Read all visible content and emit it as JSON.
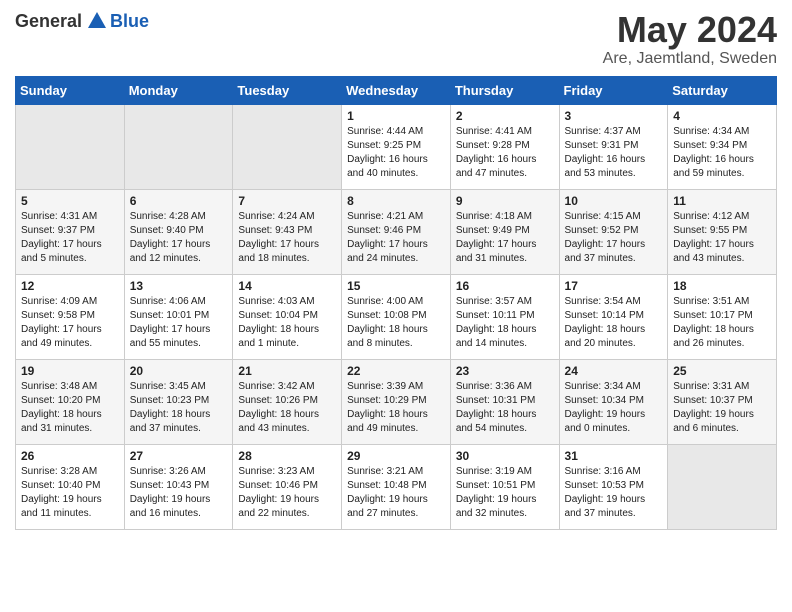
{
  "header": {
    "logo_general": "General",
    "logo_blue": "Blue",
    "month": "May 2024",
    "location": "Are, Jaemtland, Sweden"
  },
  "days_of_week": [
    "Sunday",
    "Monday",
    "Tuesday",
    "Wednesday",
    "Thursday",
    "Friday",
    "Saturday"
  ],
  "weeks": [
    [
      {
        "day": "",
        "info": ""
      },
      {
        "day": "",
        "info": ""
      },
      {
        "day": "",
        "info": ""
      },
      {
        "day": "1",
        "info": "Sunrise: 4:44 AM\nSunset: 9:25 PM\nDaylight: 16 hours\nand 40 minutes."
      },
      {
        "day": "2",
        "info": "Sunrise: 4:41 AM\nSunset: 9:28 PM\nDaylight: 16 hours\nand 47 minutes."
      },
      {
        "day": "3",
        "info": "Sunrise: 4:37 AM\nSunset: 9:31 PM\nDaylight: 16 hours\nand 53 minutes."
      },
      {
        "day": "4",
        "info": "Sunrise: 4:34 AM\nSunset: 9:34 PM\nDaylight: 16 hours\nand 59 minutes."
      }
    ],
    [
      {
        "day": "5",
        "info": "Sunrise: 4:31 AM\nSunset: 9:37 PM\nDaylight: 17 hours\nand 5 minutes."
      },
      {
        "day": "6",
        "info": "Sunrise: 4:28 AM\nSunset: 9:40 PM\nDaylight: 17 hours\nand 12 minutes."
      },
      {
        "day": "7",
        "info": "Sunrise: 4:24 AM\nSunset: 9:43 PM\nDaylight: 17 hours\nand 18 minutes."
      },
      {
        "day": "8",
        "info": "Sunrise: 4:21 AM\nSunset: 9:46 PM\nDaylight: 17 hours\nand 24 minutes."
      },
      {
        "day": "9",
        "info": "Sunrise: 4:18 AM\nSunset: 9:49 PM\nDaylight: 17 hours\nand 31 minutes."
      },
      {
        "day": "10",
        "info": "Sunrise: 4:15 AM\nSunset: 9:52 PM\nDaylight: 17 hours\nand 37 minutes."
      },
      {
        "day": "11",
        "info": "Sunrise: 4:12 AM\nSunset: 9:55 PM\nDaylight: 17 hours\nand 43 minutes."
      }
    ],
    [
      {
        "day": "12",
        "info": "Sunrise: 4:09 AM\nSunset: 9:58 PM\nDaylight: 17 hours\nand 49 minutes."
      },
      {
        "day": "13",
        "info": "Sunrise: 4:06 AM\nSunset: 10:01 PM\nDaylight: 17 hours\nand 55 minutes."
      },
      {
        "day": "14",
        "info": "Sunrise: 4:03 AM\nSunset: 10:04 PM\nDaylight: 18 hours\nand 1 minute."
      },
      {
        "day": "15",
        "info": "Sunrise: 4:00 AM\nSunset: 10:08 PM\nDaylight: 18 hours\nand 8 minutes."
      },
      {
        "day": "16",
        "info": "Sunrise: 3:57 AM\nSunset: 10:11 PM\nDaylight: 18 hours\nand 14 minutes."
      },
      {
        "day": "17",
        "info": "Sunrise: 3:54 AM\nSunset: 10:14 PM\nDaylight: 18 hours\nand 20 minutes."
      },
      {
        "day": "18",
        "info": "Sunrise: 3:51 AM\nSunset: 10:17 PM\nDaylight: 18 hours\nand 26 minutes."
      }
    ],
    [
      {
        "day": "19",
        "info": "Sunrise: 3:48 AM\nSunset: 10:20 PM\nDaylight: 18 hours\nand 31 minutes."
      },
      {
        "day": "20",
        "info": "Sunrise: 3:45 AM\nSunset: 10:23 PM\nDaylight: 18 hours\nand 37 minutes."
      },
      {
        "day": "21",
        "info": "Sunrise: 3:42 AM\nSunset: 10:26 PM\nDaylight: 18 hours\nand 43 minutes."
      },
      {
        "day": "22",
        "info": "Sunrise: 3:39 AM\nSunset: 10:29 PM\nDaylight: 18 hours\nand 49 minutes."
      },
      {
        "day": "23",
        "info": "Sunrise: 3:36 AM\nSunset: 10:31 PM\nDaylight: 18 hours\nand 54 minutes."
      },
      {
        "day": "24",
        "info": "Sunrise: 3:34 AM\nSunset: 10:34 PM\nDaylight: 19 hours\nand 0 minutes."
      },
      {
        "day": "25",
        "info": "Sunrise: 3:31 AM\nSunset: 10:37 PM\nDaylight: 19 hours\nand 6 minutes."
      }
    ],
    [
      {
        "day": "26",
        "info": "Sunrise: 3:28 AM\nSunset: 10:40 PM\nDaylight: 19 hours\nand 11 minutes."
      },
      {
        "day": "27",
        "info": "Sunrise: 3:26 AM\nSunset: 10:43 PM\nDaylight: 19 hours\nand 16 minutes."
      },
      {
        "day": "28",
        "info": "Sunrise: 3:23 AM\nSunset: 10:46 PM\nDaylight: 19 hours\nand 22 minutes."
      },
      {
        "day": "29",
        "info": "Sunrise: 3:21 AM\nSunset: 10:48 PM\nDaylight: 19 hours\nand 27 minutes."
      },
      {
        "day": "30",
        "info": "Sunrise: 3:19 AM\nSunset: 10:51 PM\nDaylight: 19 hours\nand 32 minutes."
      },
      {
        "day": "31",
        "info": "Sunrise: 3:16 AM\nSunset: 10:53 PM\nDaylight: 19 hours\nand 37 minutes."
      },
      {
        "day": "",
        "info": ""
      }
    ]
  ]
}
